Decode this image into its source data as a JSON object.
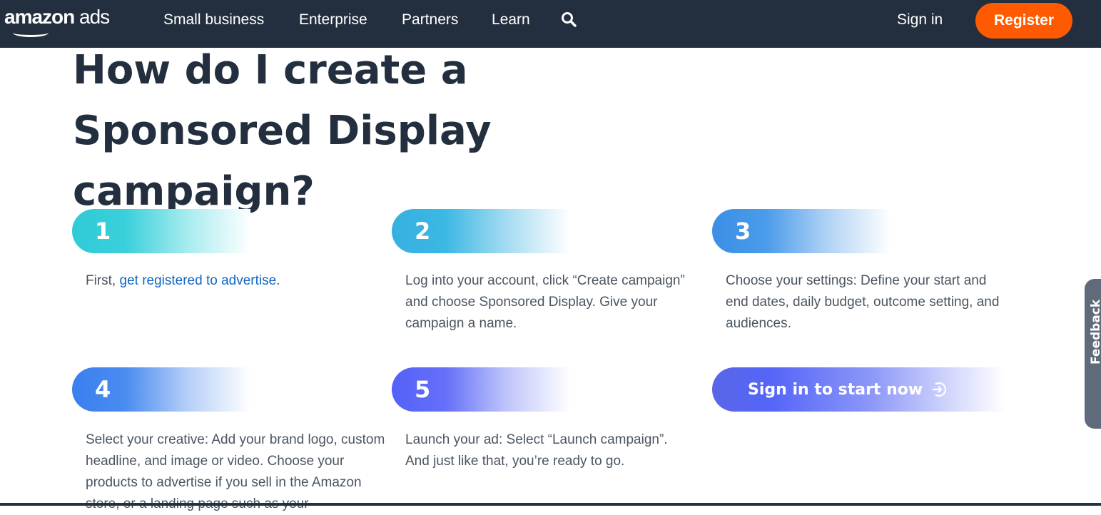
{
  "header": {
    "logo": "amazon ads",
    "nav": [
      "Small business",
      "Enterprise",
      "Partners",
      "Learn"
    ],
    "sign_in": "Sign in",
    "register": "Register"
  },
  "title": "How do I create a Sponsored Display campaign?",
  "steps": [
    {
      "number": "1",
      "text_before": "First, ",
      "link": "get registered to advertise",
      "text_after": "."
    },
    {
      "number": "2",
      "text": "Log into your account, click “Create campaign” and choose Sponsored Display. Give your campaign a name."
    },
    {
      "number": "3",
      "text": "Choose your settings: Define your start and end dates, daily budget, outcome setting, and audiences."
    },
    {
      "number": "4",
      "text": "Select your creative: Add your brand logo, custom headline, and image or video. Choose your products to advertise if you sell in the Amazon store, or a landing page such as your"
    },
    {
      "number": "5",
      "text": "Launch your ad: Select “Launch campaign”. And just like that, you’re ready to go."
    }
  ],
  "cta": "Sign in to start now",
  "feedback": "Feedback",
  "colors": {
    "header": "#232f3e",
    "register": "#ff5a00",
    "step1": "#2ecbd6",
    "step2": "#36b0e0",
    "step3": "#3a8fe6",
    "step4": "#3a7ff0",
    "step5": "#5560f8"
  }
}
